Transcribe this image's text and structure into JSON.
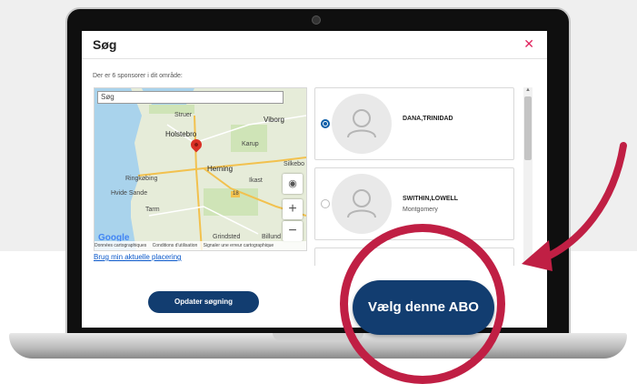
{
  "modal": {
    "title": "Søg",
    "close_icon": "close-icon",
    "subtitle": "Der er 6 sponsorer i dit område:"
  },
  "map": {
    "search_placeholder": "Søg",
    "labels": [
      "Struer",
      "Viborg",
      "Holstebro",
      "Karup",
      "Silkebo",
      "Herning",
      "Ringkøbing",
      "Ikast",
      "Hvide Sande",
      "Tarm",
      "Grindsted",
      "Billund"
    ],
    "marker_icon": "map-pin-icon",
    "locate_icon": "locate-icon",
    "zoom_in_label": "+",
    "zoom_out_label": "−",
    "logo_text": "Google",
    "footer_items": [
      "Données cartographiques",
      "Conditions d'utilisation",
      "Signaler une erreur cartographique"
    ],
    "road_number": "18"
  },
  "location_link": "Brug min aktuelle placering",
  "sponsors": [
    {
      "name": "DANA,TRINIDAD",
      "city": "",
      "selected": true
    },
    {
      "name": "SWITHIN,LOWELL",
      "city": "Montgomery",
      "selected": false
    }
  ],
  "buttons": {
    "update": "Opdater søgning",
    "select": "Vælg denne ABO"
  },
  "colors": {
    "primary": "#123d70",
    "accent_red": "#c01f44",
    "close": "#e0245e"
  }
}
